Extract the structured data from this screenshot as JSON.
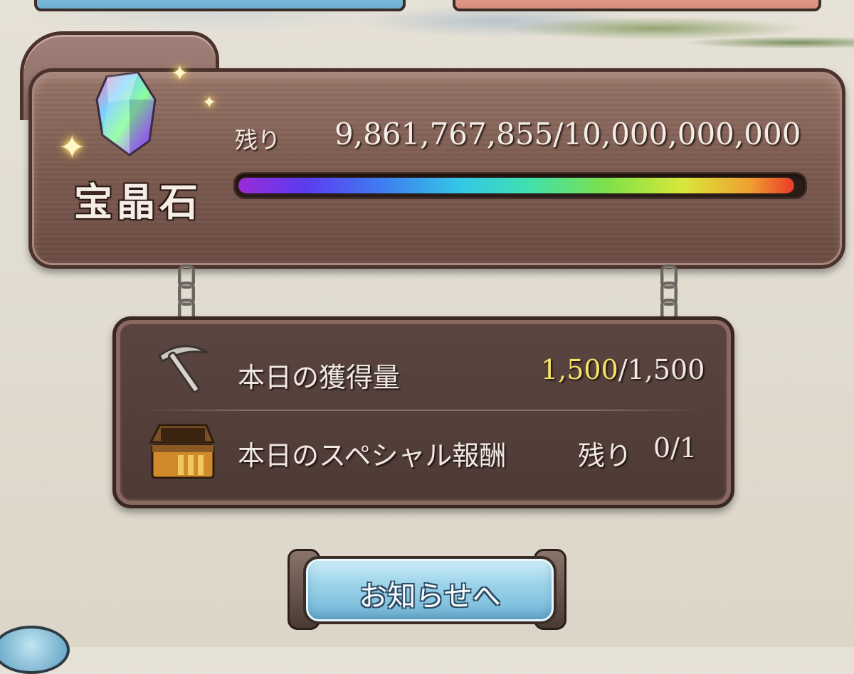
{
  "gem_panel": {
    "name": "宝晶石",
    "remaining_label": "残り",
    "remaining_value": "9,861,767,855/10,000,000,000",
    "remaining_fraction": 0.9862
  },
  "daily_panel": {
    "acquired_label": "本日の獲得量",
    "acquired_current": "1,500",
    "acquired_separator_total": "/1,500",
    "special_reward_label": "本日のスペシャル報酬",
    "special_reward_remaining_label": "残り",
    "special_reward_value": "0/1",
    "icons": [
      "pickaxe-icon",
      "treasure-chest-icon"
    ]
  },
  "notice_button": {
    "label": "お知らせへ"
  },
  "colors": {
    "highlight": "#f7e36a",
    "wood": "#7e5d52",
    "board": "#4e3a35",
    "button": "#9ed4ea"
  }
}
